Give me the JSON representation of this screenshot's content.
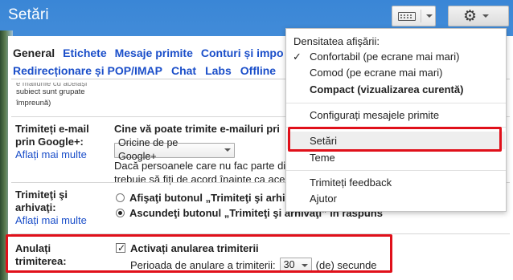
{
  "header": {
    "title": "Setări"
  },
  "toolbar": {
    "keyboard_icon": "keyboard-icon",
    "gear_icon": "gear-icon"
  },
  "tabs": {
    "row1": [
      "General",
      "Etichete",
      "Mesaje primite",
      "Conturi și impo"
    ],
    "row2": [
      "Redirecționare și POP/IMAP",
      "Chat",
      "Labs",
      "Offline"
    ]
  },
  "hint_top": {
    "cut": "e mailurile cu acelaşi",
    "line1": "subiect sunt grupate",
    "line2": "împreună)"
  },
  "settings": {
    "email_google_plus": {
      "label_line1": "Trimiteți e-mail",
      "label_line2": "prin Google+:",
      "link": "Aflați mai multe",
      "question": "Cine vă poate trimite e-mailuri pri",
      "select_value": "Oricine de pe Google+",
      "note_line1": "Dacă persoanele care nu fac parte di",
      "note_line2": "trebuie să fiți de acord înainte ca ace"
    },
    "send_archive": {
      "label_line1": "Trimiteţi şi",
      "label_line2": "arhivaţi:",
      "link": "Aflați mai multe",
      "option1": "Afişaţi butonul „Trimiteţi şi arhi",
      "option2": "Ascundeţi butonul „Trimiteţi şi arhivaţi” în răspuns"
    },
    "undo_send": {
      "label_line1": "Anulați",
      "label_line2": "trimiterea:",
      "checkbox_label": "Activați anularea trimiterii",
      "period_label": "Perioada de anulare a trimiterii:",
      "period_value": "30",
      "period_unit": "(de) secunde"
    }
  },
  "menu": {
    "heading": "Densitatea afişării:",
    "check_mark": "✓",
    "density_options": [
      "Confortabil (pe ecrane mai mari)",
      "Comod (pe ecrane mai mari)",
      "Compact (vizualizarea curentă)"
    ],
    "configure_inbox": "Configurați mesajele primite",
    "settings": "Setări",
    "themes": "Teme",
    "feedback": "Trimiteți feedback",
    "help": "Ajutor"
  },
  "colors": {
    "highlight_border": "#e0101a",
    "link": "#1a4ec9"
  }
}
